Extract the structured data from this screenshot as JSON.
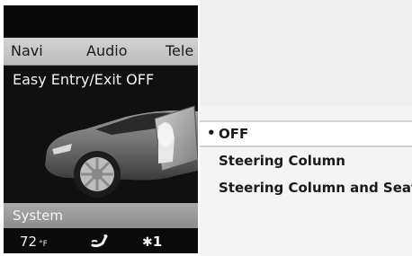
{
  "menu": {
    "items": [
      {
        "label": "Navi"
      },
      {
        "label": "Audio"
      },
      {
        "label": "Tele"
      }
    ]
  },
  "screen_title": "Easy Entry/Exit OFF",
  "system_bar": {
    "label": "System"
  },
  "status": {
    "temperature_value": "72",
    "temperature_unit": "°F",
    "seat_icon": "seat-heating-icon",
    "fan_icon": "fan-icon",
    "fan_level": "1"
  },
  "options": {
    "selected_bullet": "•",
    "items": [
      {
        "label": "OFF",
        "selected": true
      },
      {
        "label": "Steering Column",
        "selected": false
      },
      {
        "label": "Steering Column and Seat",
        "selected": false
      }
    ]
  },
  "colors": {
    "menubar": "#c8c8c8",
    "screen_bg": "#101010",
    "system_bar": "#9d9d9d",
    "panel_bg": "#f4f4f4"
  }
}
